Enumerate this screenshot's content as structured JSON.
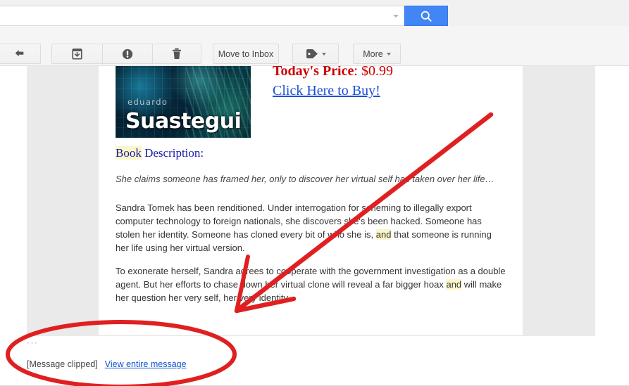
{
  "search": {
    "value": "",
    "placeholder": "",
    "dropdown_icon": "chevron-down-icon",
    "button_icon": "search-icon",
    "button_color": "#4285f4"
  },
  "toolbar": {
    "back_label": "↩",
    "back_icon": "back-arrow-icon",
    "archive_icon": "archive-icon",
    "spam_icon": "report-spam-icon",
    "delete_icon": "trash-icon",
    "move_to_inbox_label": "Move to Inbox",
    "labels_icon": "label-tag-icon",
    "more_label": "More"
  },
  "message": {
    "cover": {
      "author": "eduardo",
      "title": "Suastegui",
      "alt": "book-cover-image"
    },
    "price_label": "Today's Price",
    "price_separator": ": ",
    "price_value": "$0.99",
    "price_color": "#cc0000",
    "buy_link": "Click Here to Buy!",
    "buy_link_color": "#1a4fd6",
    "description_heading_highlight": "Book",
    "description_heading_rest": " Description:",
    "tagline": "She claims someone has framed her, only to discover her virtual self has taken over her life…",
    "paragraph_1_part_1": "Sandra Tomek has been renditioned. Under interrogation for scheming to illegally export computer technology to foreign nationals, she discovers she's been hacked. Someone has stolen her identity. Someone has cloned every bit of who she is, ",
    "paragraph_1_highlight": "and",
    "paragraph_1_part_2": " that someone is running her life using her virtual version.",
    "paragraph_2_part_1": "To exonerate herself, Sandra agrees to cooperate with the government investigation as a double agent. But her efforts to chase down her virtual clone will reveal a far bigger hoax ",
    "paragraph_2_highlight": "and",
    "paragraph_2_part_2": " will make her question her very self, her very identity.",
    "highlight_color": "#fbf6c8"
  },
  "footer": {
    "expand_ellipsis": "···",
    "clipped_label": "[Message clipped]",
    "view_entire_label": "View entire message",
    "link_color": "#1155cc"
  },
  "annotations": {
    "arrow_color": "#e02020",
    "circle_color": "#e02020",
    "arrow_from": "697,163",
    "arrow_to": "333,443",
    "circle_center": "172,504"
  }
}
